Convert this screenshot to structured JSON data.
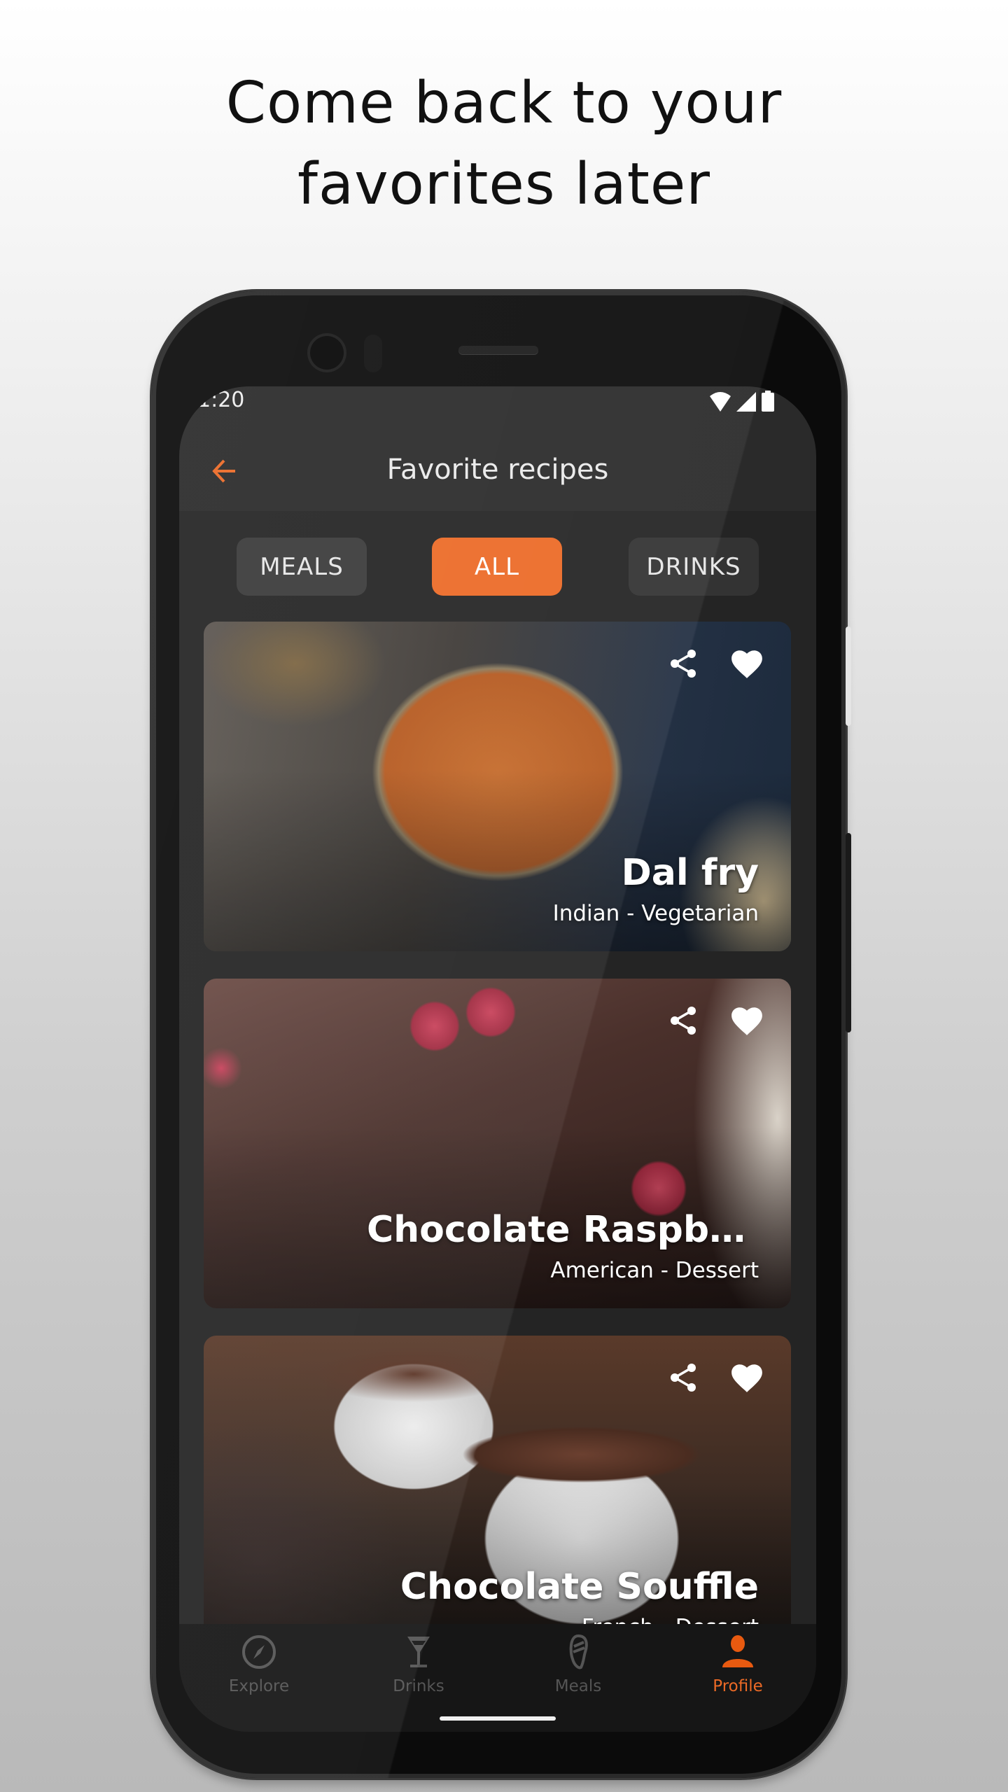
{
  "headline": {
    "line1": "Come back to your",
    "line2": "favorites later"
  },
  "status_bar": {
    "time": "1:20",
    "icons": [
      "wifi-icon",
      "signal-icon",
      "battery-icon"
    ]
  },
  "app_bar": {
    "title": "Favorite recipes",
    "back_icon": "arrow-left-icon"
  },
  "filters": [
    {
      "label": "MEALS",
      "selected": false
    },
    {
      "label": "ALL",
      "selected": true
    },
    {
      "label": "DRINKS",
      "selected": false
    }
  ],
  "recipes": [
    {
      "name": "Dal fry",
      "subtitle": "Indian - Vegetarian",
      "favorited": true
    },
    {
      "name": "Chocolate Raspberr...",
      "subtitle": "American - Dessert",
      "favorited": true
    },
    {
      "name": "Chocolate Souffle",
      "subtitle": "French - Dessert",
      "favorited": true
    }
  ],
  "bottom_nav": [
    {
      "label": "Explore",
      "icon": "compass-icon",
      "active": false
    },
    {
      "label": "Drinks",
      "icon": "cocktail-icon",
      "active": false
    },
    {
      "label": "Meals",
      "icon": "meat-icon",
      "active": false
    },
    {
      "label": "Profile",
      "icon": "person-icon",
      "active": true
    }
  ],
  "colors": {
    "accent": "#EC6A26",
    "background": "#242424",
    "appbar": "#2A2A2A",
    "chip": "#3A3A3A",
    "nav_inactive": "#555555"
  }
}
